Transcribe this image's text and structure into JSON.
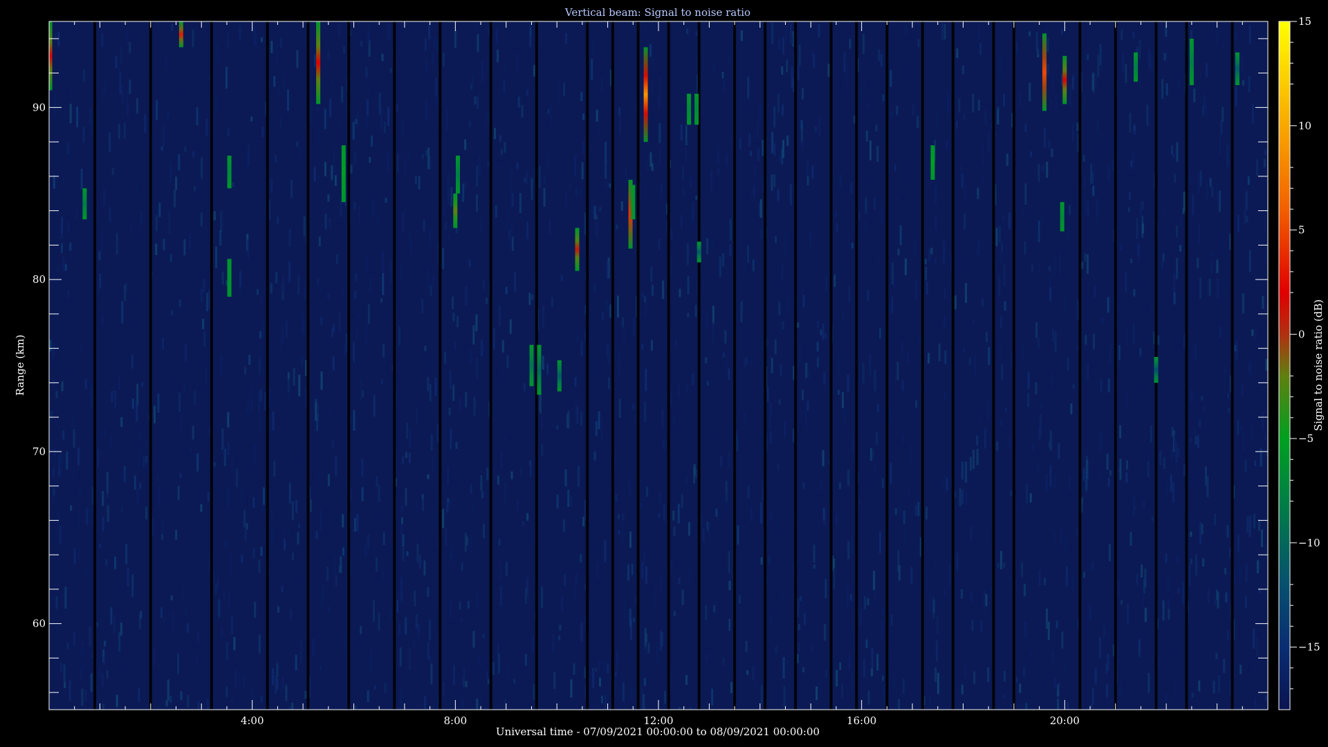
{
  "chart_data": {
    "type": "heatmap",
    "title": "Vertical beam: Signal to noise ratio",
    "xlabel": "Universal time - 07/09/2021 00:00:00 to 08/09/2021 00:00:00",
    "ylabel": "Range (km)",
    "colorbar_label": "Signal to noise ratio (dB)",
    "xlim_hours": [
      0,
      24
    ],
    "ylim_km": [
      55,
      95
    ],
    "clim_db": [
      -18,
      15
    ],
    "x_ticks": [
      {
        "hour": 4,
        "label": "4:00"
      },
      {
        "hour": 8,
        "label": "8:00"
      },
      {
        "hour": 12,
        "label": "12:00"
      },
      {
        "hour": 16,
        "label": "16:00"
      },
      {
        "hour": 20,
        "label": "20:00"
      }
    ],
    "y_ticks": [
      {
        "km": 60,
        "label": "60"
      },
      {
        "km": 70,
        "label": "70"
      },
      {
        "km": 80,
        "label": "80"
      },
      {
        "km": 90,
        "label": "90"
      }
    ],
    "colorbar_ticks": [
      {
        "db": 15,
        "label": "15"
      },
      {
        "db": 10,
        "label": "10"
      },
      {
        "db": 5,
        "label": "5"
      },
      {
        "db": 0,
        "label": "0"
      },
      {
        "db": -5,
        "label": "−5"
      },
      {
        "db": -10,
        "label": "−10"
      },
      {
        "db": -15,
        "label": "−15"
      }
    ],
    "colormap": [
      "#0a1450",
      "#0a2d73",
      "#07506e",
      "#007f45",
      "#00a020",
      "#608010",
      "#b03010",
      "#e00000",
      "#f26000",
      "#f9a800",
      "#ffff00"
    ],
    "colorscale_stops": [
      -18,
      -15,
      -12,
      -8,
      -5,
      -2,
      0,
      2,
      6,
      10,
      15
    ],
    "background_db": -15,
    "data_gap_hours": [
      0.9,
      2.0,
      3.2,
      4.3,
      5.1,
      5.9,
      6.8,
      7.7,
      8.7,
      9.6,
      10.6,
      11.1,
      11.6,
      12.2,
      12.8,
      13.5,
      14.1,
      14.7,
      15.4,
      15.9,
      16.5,
      17.2,
      17.8,
      18.6,
      19.0,
      20.3,
      21.0,
      21.8,
      22.4,
      23.3
    ],
    "echoes": [
      {
        "hour": 0.02,
        "km_start": 91.0,
        "km_end": 95.0,
        "db_peak": 2
      },
      {
        "hour": 0.7,
        "km_start": 83.5,
        "km_end": 85.3,
        "db_peak": -8
      },
      {
        "hour": 2.6,
        "km_start": 93.5,
        "km_end": 95.0,
        "db_peak": 3
      },
      {
        "hour": 3.55,
        "km_start": 85.3,
        "km_end": 87.2,
        "db_peak": -7
      },
      {
        "hour": 3.55,
        "km_start": 79.0,
        "km_end": 81.2,
        "db_peak": -6
      },
      {
        "hour": 5.3,
        "km_start": 90.2,
        "km_end": 95.0,
        "db_peak": 2
      },
      {
        "hour": 5.8,
        "km_start": 84.5,
        "km_end": 87.8,
        "db_peak": -5
      },
      {
        "hour": 8.0,
        "km_start": 83.0,
        "km_end": 85.0,
        "db_peak": -2
      },
      {
        "hour": 8.05,
        "km_start": 85.0,
        "km_end": 87.2,
        "db_peak": -8
      },
      {
        "hour": 9.5,
        "km_start": 73.8,
        "km_end": 76.2,
        "db_peak": -9
      },
      {
        "hour": 9.65,
        "km_start": 73.3,
        "km_end": 76.2,
        "db_peak": -10
      },
      {
        "hour": 10.05,
        "km_start": 73.5,
        "km_end": 75.3,
        "db_peak": -11
      },
      {
        "hour": 10.4,
        "km_start": 80.5,
        "km_end": 83.0,
        "db_peak": 1
      },
      {
        "hour": 11.45,
        "km_start": 81.8,
        "km_end": 85.8,
        "db_peak": 4
      },
      {
        "hour": 11.5,
        "km_start": 83.5,
        "km_end": 85.5,
        "db_peak": -6
      },
      {
        "hour": 11.75,
        "km_start": 88.0,
        "km_end": 93.5,
        "db_peak": 9
      },
      {
        "hour": 12.6,
        "km_start": 89.0,
        "km_end": 90.8,
        "db_peak": -7
      },
      {
        "hour": 12.75,
        "km_start": 89.0,
        "km_end": 90.8,
        "db_peak": -7
      },
      {
        "hour": 12.8,
        "km_start": 81.0,
        "km_end": 82.2,
        "db_peak": -11
      },
      {
        "hour": 17.4,
        "km_start": 85.8,
        "km_end": 87.8,
        "db_peak": -5
      },
      {
        "hour": 19.6,
        "km_start": 89.8,
        "km_end": 94.3,
        "db_peak": 5
      },
      {
        "hour": 19.95,
        "km_start": 82.8,
        "km_end": 84.5,
        "db_peak": -7
      },
      {
        "hour": 20.0,
        "km_start": 90.2,
        "km_end": 93.0,
        "db_peak": 2
      },
      {
        "hour": 21.4,
        "km_start": 91.5,
        "km_end": 93.2,
        "db_peak": -8
      },
      {
        "hour": 21.8,
        "km_start": 74.0,
        "km_end": 75.5,
        "db_peak": -12
      },
      {
        "hour": 22.5,
        "km_start": 91.3,
        "km_end": 94.0,
        "db_peak": -8
      },
      {
        "hour": 23.4,
        "km_start": 91.3,
        "km_end": 93.2,
        "db_peak": -11
      }
    ]
  }
}
